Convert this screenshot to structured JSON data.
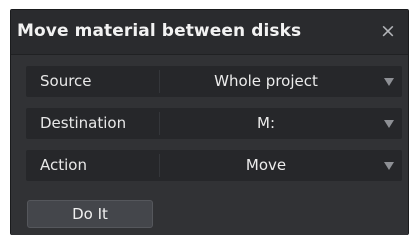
{
  "dialog": {
    "title": "Move material between disks",
    "close_glyph": "×"
  },
  "fields": [
    {
      "label": "Source",
      "value": "Whole project"
    },
    {
      "label": "Destination",
      "value": "M:"
    },
    {
      "label": "Action",
      "value": "Move"
    }
  ],
  "actions": {
    "do_it_label": "Do It"
  },
  "colors": {
    "dialog_bg": "#303235",
    "titlebar_bg": "#2a2b2e",
    "row_bg": "#26272a",
    "button_bg": "#44464b",
    "text": "#e6e6e6",
    "arrow": "#8e9095"
  },
  "icons": {
    "close": "close-icon",
    "dropdown": "chevron-down-icon"
  }
}
